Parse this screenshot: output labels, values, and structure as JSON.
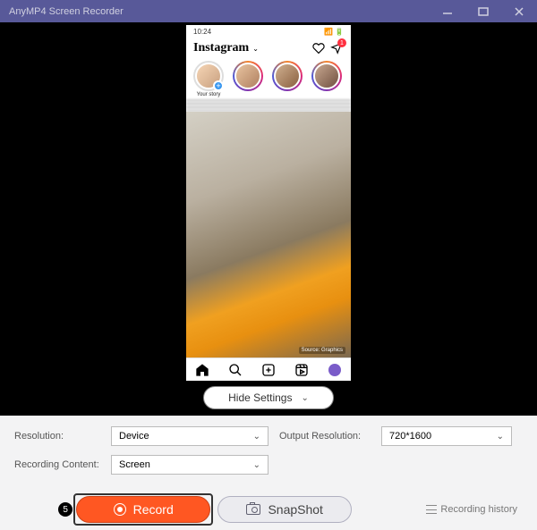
{
  "titlebar": {
    "app_name": "AnyMP4 Screen Recorder"
  },
  "phone": {
    "status_time": "10:24",
    "ig_logo": "Instagram",
    "dm_badge": "1",
    "your_story": "Your story",
    "watermark": "Source: Graphics"
  },
  "hide_settings_label": "Hide Settings",
  "settings": {
    "resolution_label": "Resolution:",
    "resolution_value": "Device",
    "output_label": "Output Resolution:",
    "output_value": "720*1600",
    "content_label": "Recording Content:",
    "content_value": "Screen"
  },
  "actions": {
    "record_label": "Record",
    "snapshot_label": "SnapShot",
    "history_label": "Recording history",
    "step_number": "5"
  }
}
